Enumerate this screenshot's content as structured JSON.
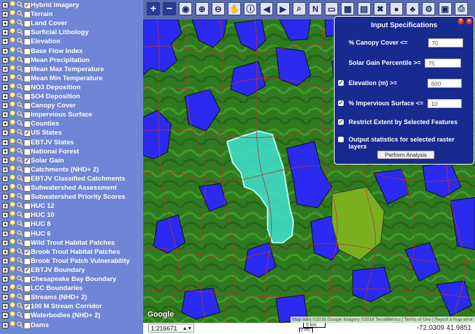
{
  "sidebar": {
    "layers": [
      {
        "label": "Hybrid Imagery",
        "checked": true
      },
      {
        "label": "Terrain",
        "checked": false
      },
      {
        "label": "Land Cover",
        "checked": false
      },
      {
        "label": "Surficial Lithology",
        "checked": false
      },
      {
        "label": "Elevation",
        "checked": false
      },
      {
        "label": "Base Flow Index",
        "checked": false
      },
      {
        "label": "Mean Precipitation",
        "checked": false
      },
      {
        "label": "Mean Max Temperature",
        "checked": false
      },
      {
        "label": "Mean Min Temperature",
        "checked": false
      },
      {
        "label": "NO3 Deposition",
        "checked": false
      },
      {
        "label": "SO4 Deposition",
        "checked": false
      },
      {
        "label": "Canopy Cover",
        "checked": false
      },
      {
        "label": "Impervious Surface",
        "checked": false
      },
      {
        "label": "Counties",
        "checked": false
      },
      {
        "label": "US States",
        "checked": true
      },
      {
        "label": "EBTJV States",
        "checked": false
      },
      {
        "label": "National Forest",
        "checked": false
      },
      {
        "label": "Solar Gain",
        "checked": true
      },
      {
        "label": "Catchments (NHD+ 2)",
        "checked": false
      },
      {
        "label": "EBTJV Classified Catchments",
        "checked": false
      },
      {
        "label": "Subwatershed Assessment",
        "checked": false
      },
      {
        "label": "Subwatershed Priority Scores",
        "checked": false
      },
      {
        "label": "HUC 12",
        "checked": false
      },
      {
        "label": "HUC 10",
        "checked": false
      },
      {
        "label": "HUC 8",
        "checked": false
      },
      {
        "label": "HUC 6",
        "checked": false
      },
      {
        "label": "Wild Trout Habitat Patches",
        "checked": false
      },
      {
        "label": "Brook Trout Habitat Patches",
        "checked": true
      },
      {
        "label": "Brook Trout Patch Vulnerability",
        "checked": false
      },
      {
        "label": "EBTJV Boundary",
        "checked": true
      },
      {
        "label": "Chesapeake Bay Boundary",
        "checked": false
      },
      {
        "label": "LCC Boundaries",
        "checked": false
      },
      {
        "label": "Streams (NHD+ 2)",
        "checked": false
      },
      {
        "label": "100 M Stream Corridor",
        "checked": true
      },
      {
        "label": "Waterbodies (NHD+ 2)",
        "checked": false
      },
      {
        "label": "Dams",
        "checked": false
      }
    ]
  },
  "toolbar": {
    "tools": [
      "zoom-in-icon",
      "zoom-out-icon",
      "full-extent-icon",
      "zoom-box-in-icon",
      "zoom-box-out-icon",
      "pan-hand-icon",
      "identify-icon",
      "previous-extent-icon",
      "next-extent-icon",
      "find-icon",
      "north-arrow-icon",
      "measure-icon",
      "select-features-icon",
      "legend-icon",
      "clear-selection-icon",
      "analysis-icon",
      "tree-icon",
      "settings-icon",
      "bookmark-icon",
      "print-icon"
    ]
  },
  "dialog": {
    "title": "Input Specifications",
    "help": "?",
    "close": "×",
    "canopy_label": "% Canopy Cover <=",
    "canopy_value": "70",
    "solar_label": "Solar Gain Percentile >=",
    "solar_value": "75",
    "elevation_label": "Elevation (m) >=",
    "elevation_value": "600",
    "elevation_checked": true,
    "impervious_label": "% Impervious Surface <=",
    "impervious_value": "10",
    "impervious_checked": true,
    "restrict_label": "Restrict Extent by Selected Features",
    "restrict_checked": true,
    "stats_label": "Output statistics for selected raster layers",
    "stats_checked": false,
    "perform_label": "Perform Analysis"
  },
  "status": {
    "scale": "1:216671",
    "coords": "-72.0309 41.9851",
    "scalebar_km": "5 km",
    "scalebar_mi": "2 mi"
  },
  "map": {
    "attribution": "Map data ©2016 Google Imagery ©2016 TerraMetrics  |  Terms of Use  |  Report a map error",
    "google_logo": "Google",
    "colors": {
      "base_green": "#2f7a1e",
      "solar_blue": "#2a2af0",
      "selected_cyan": "#40e0d0",
      "boundary_red": "#c03030",
      "light_patch": "#7ab020"
    }
  }
}
